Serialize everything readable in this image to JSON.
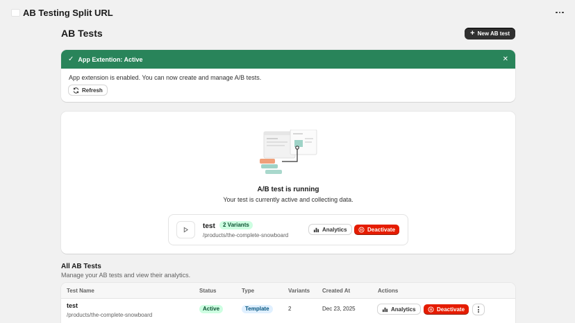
{
  "app": {
    "title": "AB Testing Split URL"
  },
  "page": {
    "title": "AB Tests",
    "new_button_label": "New AB test"
  },
  "banner": {
    "title": "App Extention: Active",
    "message": "App extension is enabled. You can now create and manage A/B tests.",
    "refresh_label": "Refresh",
    "color": "#29845a"
  },
  "running": {
    "title": "A/B test is running",
    "subtitle": "Your test is currently active and collecting data.",
    "test": {
      "name": "test",
      "variants_badge": "2 Variants",
      "path": "/products/the-complete-snowboard",
      "analytics_label": "Analytics",
      "deactivate_label": "Deactivate"
    }
  },
  "all_tests": {
    "title": "All AB Tests",
    "subtitle": "Manage your AB tests and view their analytics.",
    "columns": [
      "Test Name",
      "Status",
      "Type",
      "Variants",
      "Created At",
      "Actions"
    ],
    "rows": [
      {
        "name": "test",
        "path": "/products/the-complete-snowboard",
        "status": "Active",
        "type": "Template",
        "variants": "2",
        "created_at": "Dec 23, 2025",
        "analytics_label": "Analytics",
        "deactivate_label": "Deactivate"
      }
    ]
  },
  "colors": {
    "critical": "#e51c00",
    "primary": "#303030",
    "success_bg": "#cdfee1",
    "info_bg": "#e0f0ff"
  }
}
